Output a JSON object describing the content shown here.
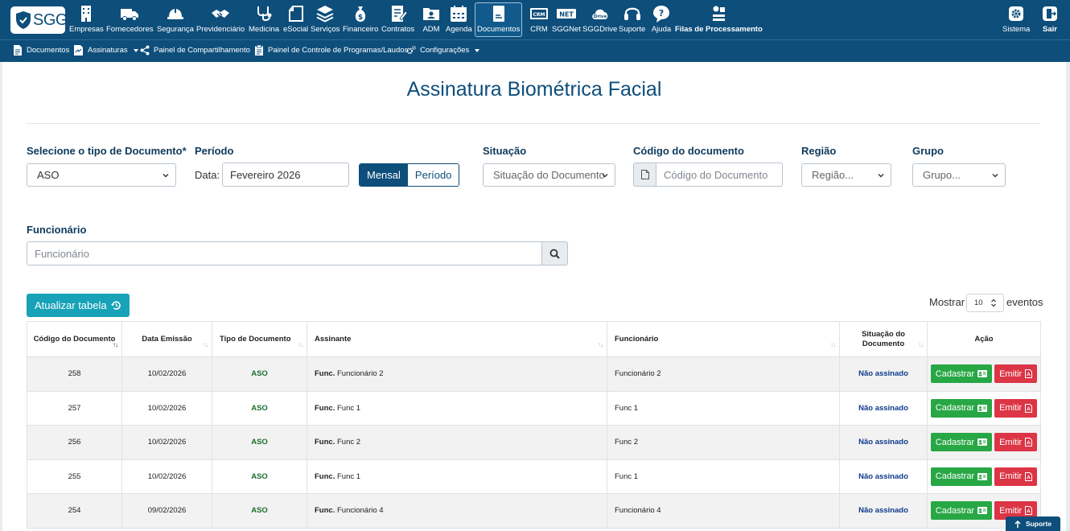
{
  "brand": {
    "logo_text": "SGG"
  },
  "nav": {
    "items": [
      {
        "key": "empresas",
        "label": "Empresas",
        "icon": "building-icon"
      },
      {
        "key": "fornecedores",
        "label": "Fornecedores",
        "icon": "truck-icon"
      },
      {
        "key": "seguranca",
        "label": "Segurança",
        "icon": "hard-hat-icon"
      },
      {
        "key": "previdenciario",
        "label": "Previdenciário",
        "icon": "handshake-icon"
      },
      {
        "key": "medicina",
        "label": "Medicina",
        "icon": "stethoscope-icon"
      },
      {
        "key": "esocial",
        "label": "eSocial",
        "icon": "esocial-icon"
      },
      {
        "key": "servicos",
        "label": "Serviços",
        "icon": "layers-icon"
      },
      {
        "key": "financeiro",
        "label": "Financeiro",
        "icon": "money-bag-icon"
      },
      {
        "key": "contratos",
        "label": "Contratos",
        "icon": "contract-icon"
      },
      {
        "key": "adm",
        "label": "ADM",
        "icon": "folder-user-icon"
      },
      {
        "key": "agenda",
        "label": "Agenda",
        "icon": "calendar-icon"
      },
      {
        "key": "documentos",
        "label": "Documentos",
        "icon": "document-icon",
        "active": true
      },
      {
        "key": "crm",
        "label": "CRM",
        "icon": "crm-icon"
      },
      {
        "key": "sggnet",
        "label": "SGGNet",
        "icon": "net-icon"
      },
      {
        "key": "sggdrive",
        "label": "SGGDrive",
        "icon": "drive-cloud-icon"
      },
      {
        "key": "suporte",
        "label": "Suporte",
        "icon": "headset-icon"
      },
      {
        "key": "ajuda",
        "label": "Ajuda",
        "icon": "help-bubble-icon"
      },
      {
        "key": "filas",
        "label": "Filas de Processamento",
        "icon": "process-queue-icon"
      }
    ],
    "sistema_label": "Sistema",
    "sair_label": "Sair"
  },
  "subnav": {
    "documentos": "Documentos",
    "assinaturas": "Assinaturas",
    "compartilhamento": "Painel de Compartilhamento",
    "controle": "Painel de Controle de Programas/Laudos",
    "configuracoes": "Configurações"
  },
  "page": {
    "title": "Assinatura Biométrica Facial"
  },
  "filters": {
    "tipo_label": "Selecione o tipo de Documento*",
    "tipo_value": "ASO",
    "periodo_label": "Período",
    "data_label": "Data:",
    "data_value": "Fevereiro 2026",
    "mensal_label": "Mensal",
    "periodo_btn_label": "Período",
    "situacao_label": "Situação",
    "situacao_placeholder": "Situação do Documento",
    "codigo_label": "Código do documento",
    "codigo_placeholder": "Código do Documento",
    "regiao_label": "Região",
    "regiao_placeholder": "Região...",
    "grupo_label": "Grupo",
    "grupo_placeholder": "Grupo...",
    "funcionario_label": "Funcionário",
    "funcionario_placeholder": "Funcionário"
  },
  "table_controls": {
    "refresh_label": "Atualizar tabela",
    "show_label": "Mostrar",
    "show_value": "10",
    "events_label": "eventos"
  },
  "table": {
    "headers": {
      "codigo": "Código do Documento",
      "data": "Data Emissão",
      "tipo": "Tipo de Documento",
      "assinante": "Assinante",
      "funcionario": "Funcionário",
      "situacao": "Situação do Documento",
      "acao": "Ação"
    },
    "rows": [
      {
        "codigo": "258",
        "data": "10/02/2026",
        "tipo": "ASO",
        "assinante_prefix": "Func.",
        "assinante": "Funcionário 2",
        "funcionario": "Funcionário 2",
        "situacao": "Não assinado",
        "cadastrar": "Cadastrar",
        "emitir": "Emitir"
      },
      {
        "codigo": "257",
        "data": "10/02/2026",
        "tipo": "ASO",
        "assinante_prefix": "Func.",
        "assinante": "Func 1",
        "funcionario": "Func 1",
        "situacao": "Não assinado",
        "cadastrar": "Cadastrar",
        "emitir": "Emitir"
      },
      {
        "codigo": "256",
        "data": "10/02/2026",
        "tipo": "ASO",
        "assinante_prefix": "Func.",
        "assinante": "Func 2",
        "funcionario": "Func 2",
        "situacao": "Não assinado",
        "cadastrar": "Cadastrar",
        "emitir": "Emitir"
      },
      {
        "codigo": "255",
        "data": "10/02/2026",
        "tipo": "ASO",
        "assinante_prefix": "Func.",
        "assinante": "Func 1",
        "funcionario": "Func 1",
        "situacao": "Não assinado",
        "cadastrar": "Cadastrar",
        "emitir": "Emitir"
      },
      {
        "codigo": "254",
        "data": "09/02/2026",
        "tipo": "ASO",
        "assinante_prefix": "Func.",
        "assinante": "Funcionário 4",
        "funcionario": "Funcionário 4",
        "situacao": "Não assinado",
        "cadastrar": "Cadastrar",
        "emitir": "Emitir"
      }
    ]
  },
  "support_tab": {
    "label": "Suporte"
  },
  "colors": {
    "primary": "#0e4e7b",
    "info": "#17a2b8",
    "success": "#28a745",
    "danger": "#dc3545"
  }
}
